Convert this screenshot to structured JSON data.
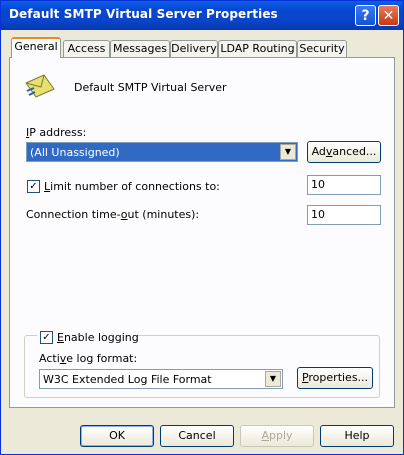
{
  "window": {
    "title": "Default SMTP Virtual Server Properties",
    "help_glyph": "?",
    "close_glyph": "✕"
  },
  "tabs": [
    {
      "label": "General",
      "active": true
    },
    {
      "label": "Access"
    },
    {
      "label": "Messages"
    },
    {
      "label": "Delivery"
    },
    {
      "label": "LDAP Routing"
    },
    {
      "label": "Security"
    }
  ],
  "general": {
    "server_icon": "envelope-icon",
    "server_name": "Default SMTP Virtual Server",
    "ip_label_mnemonic": "I",
    "ip_label_rest": "P address:",
    "ip_value": "(All Unassigned)",
    "advanced_mnemonic": "v",
    "advanced_pre": "Ad",
    "advanced_post": "anced...",
    "limit_checked": "✓",
    "limit_mnemonic": "L",
    "limit_rest": "imit number of connections to:",
    "limit_value": "10",
    "timeout_pre": "Connection time-",
    "timeout_mnemonic": "o",
    "timeout_post": "ut (minutes):",
    "timeout_value": "10",
    "logging_checked": "✓",
    "logging_mnemonic": "E",
    "logging_rest": "nable logging",
    "log_format_pre": "Acti",
    "log_format_mnemonic": "v",
    "log_format_post": "e log format:",
    "log_format_value": "W3C Extended Log File Format",
    "properties_mnemonic": "P",
    "properties_rest": "roperties..."
  },
  "footer": {
    "ok": "OK",
    "cancel": "Cancel",
    "apply_mnemonic": "A",
    "apply_rest": "pply",
    "help": "Help"
  }
}
